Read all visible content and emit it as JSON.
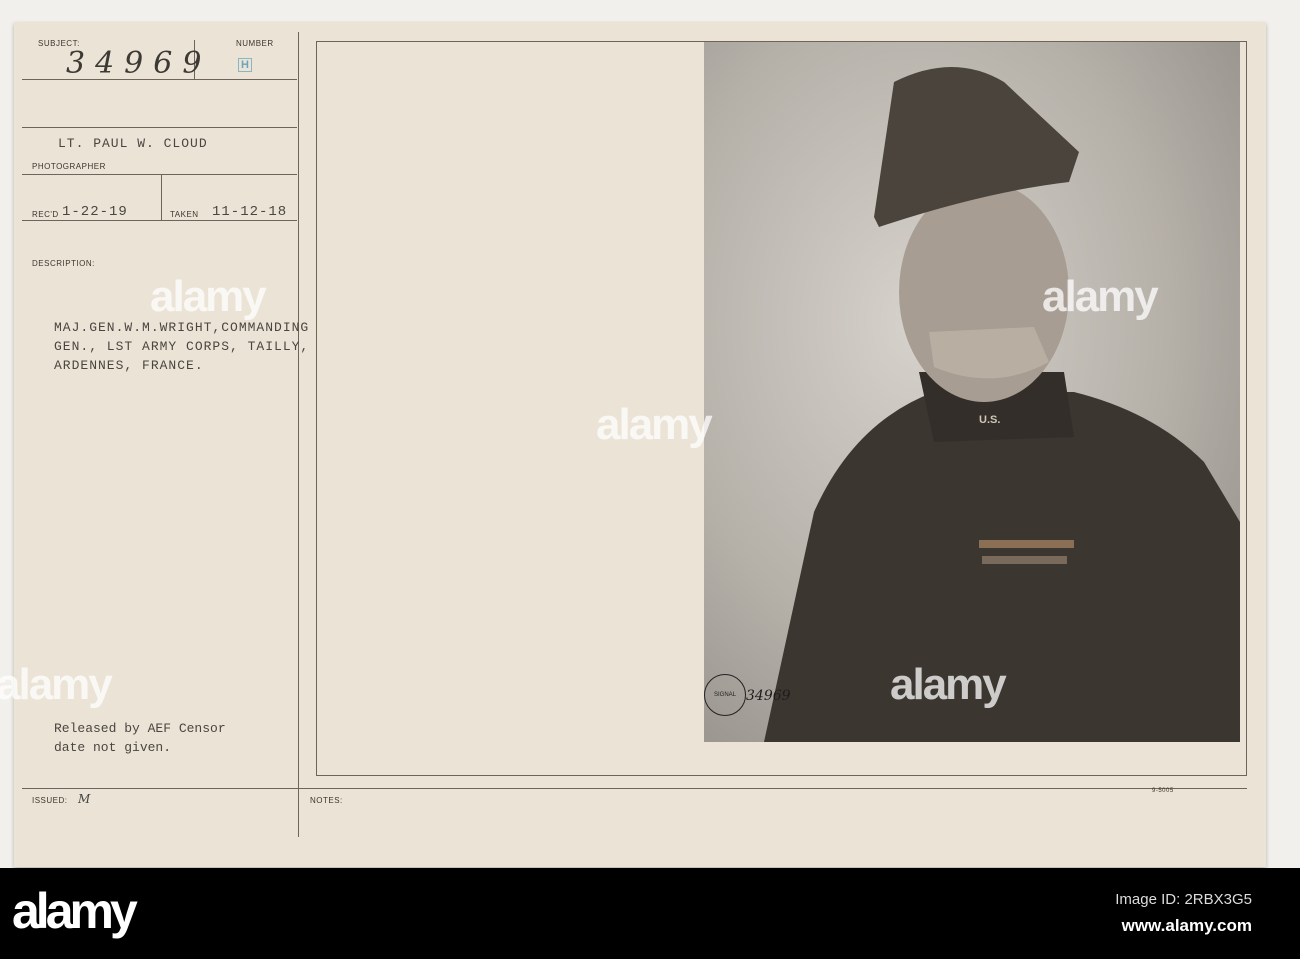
{
  "card": {
    "subject_label": "SUBJECT:",
    "subject_number": "34969",
    "number_label": "NUMBER",
    "number_stamp": "H",
    "photographer_name": "LT. PAUL W. CLOUD",
    "photographer_label": "PHOTOGRAPHER",
    "recd_label": "REC'D",
    "recd_date": "1-22-19",
    "taken_label": "TAKEN",
    "taken_date": "11-12-18",
    "description_label": "DESCRIPTION:",
    "description_lines": [
      "MAJ.GEN.W.M.WRIGHT,COMMANDING",
      "GEN., LST ARMY CORPS, TAILLY,",
      "ARDENNES, FRANCE."
    ],
    "release_lines": [
      "Released by AEF Censor",
      "date not given."
    ],
    "issued_label": "ISSUED:",
    "issued_value": "M",
    "notes_label": "NOTES:",
    "form_number": "9-5005"
  },
  "photo": {
    "stamp_text": "SIGNAL CORPS U.S.A.",
    "stamp_number": "34969",
    "collar_text": "U.S."
  },
  "watermark": "alamy",
  "footer": {
    "logo": "alamy",
    "image_id": "Image ID: 2RBX3G5",
    "site": "www.alamy.com"
  }
}
